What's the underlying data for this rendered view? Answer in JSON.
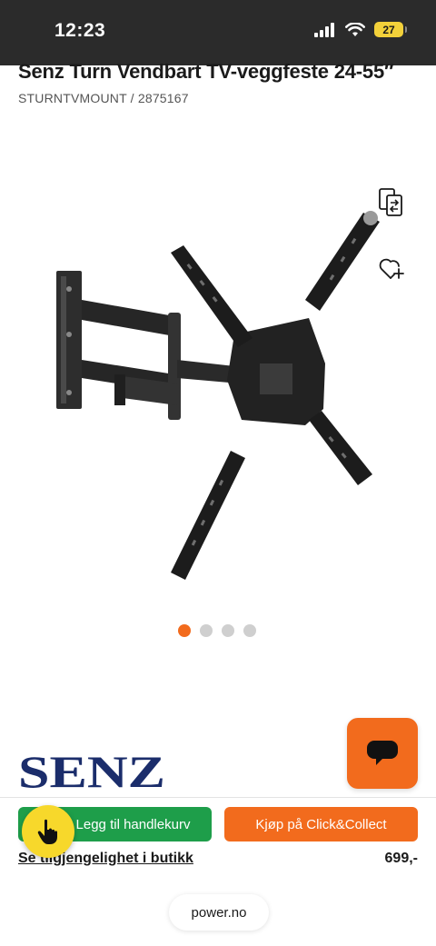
{
  "status_bar": {
    "time": "12:23",
    "battery": "27",
    "icons": [
      "cellular-signal-icon",
      "wifi-icon",
      "battery-icon"
    ]
  },
  "product": {
    "title": "Senz Turn Vendbart TV-veggfeste 24-55″",
    "sku": "STURNTVMOUNT / 2875167",
    "brand_logo_text": "SENZ",
    "image_count": 4,
    "active_image_index": 0,
    "price": "699,-"
  },
  "actions": {
    "add_to_cart_label": "Legg til handlekurv",
    "click_collect_label": "Kjøp på Click&Collect",
    "availability_link": "Se tilgjengelighet i butikk"
  },
  "browser": {
    "url": "power.no"
  },
  "colors": {
    "accent_orange": "#f26b1d",
    "cart_green": "#1e9e4a",
    "brand_navy": "#1b2d6b",
    "touch_yellow": "#f7d82b"
  }
}
